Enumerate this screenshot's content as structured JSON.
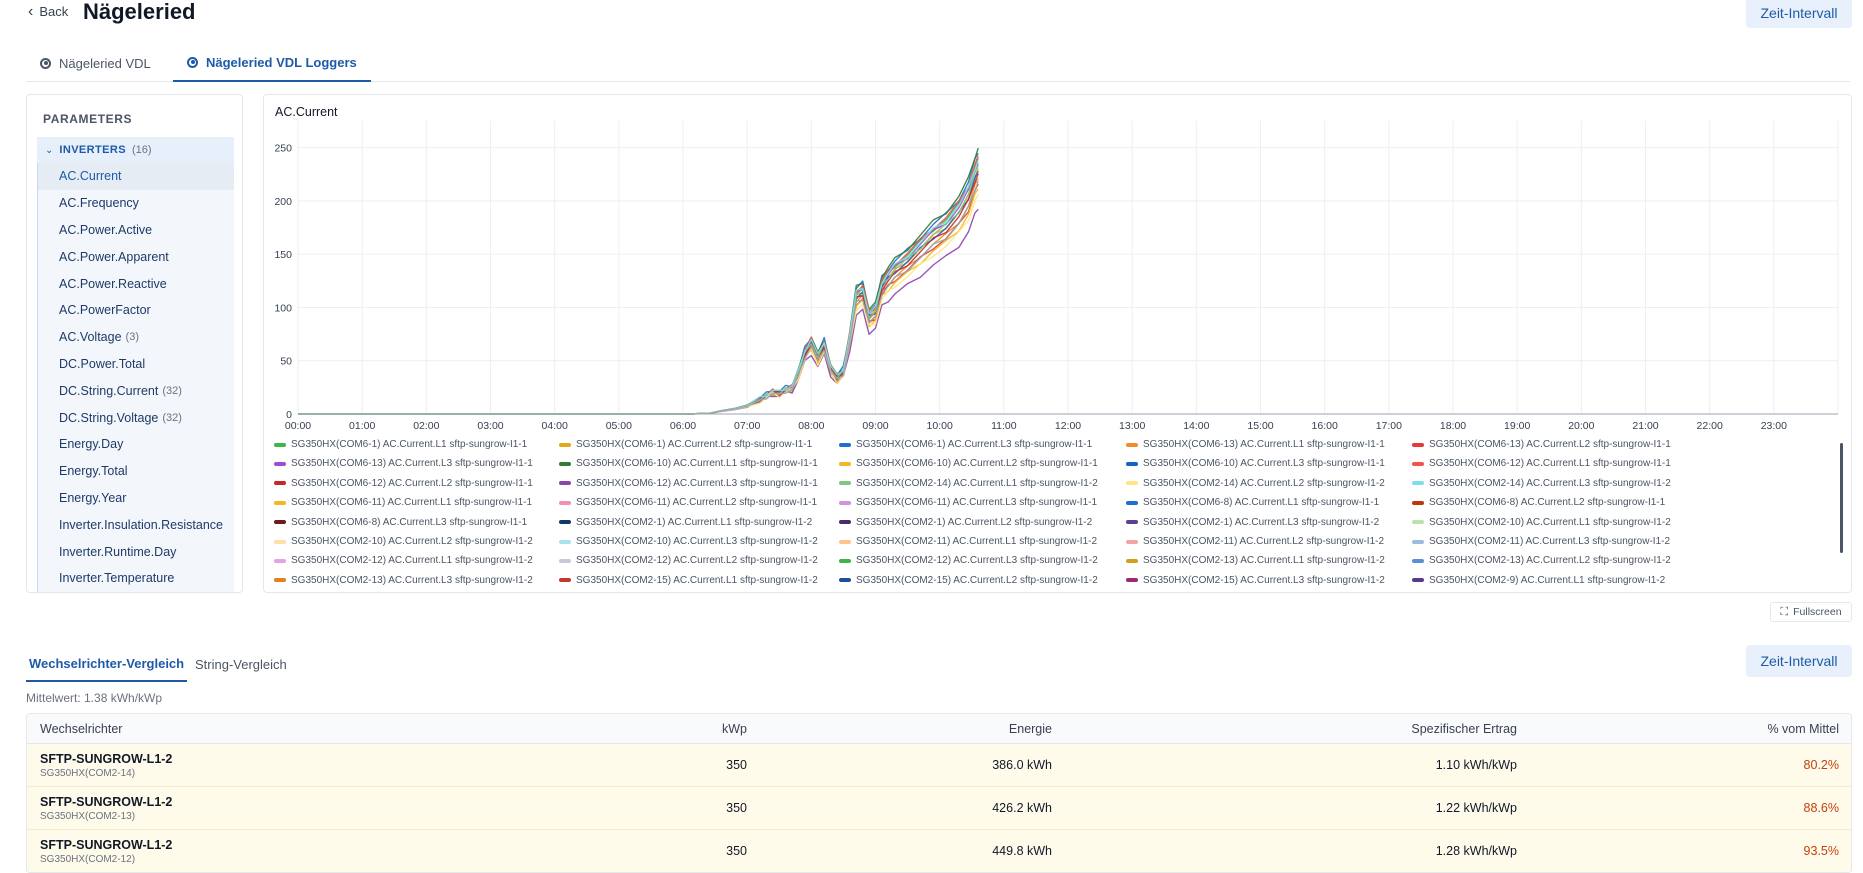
{
  "header": {
    "back_label": "Back",
    "title": "Nägeleried",
    "zeit_label": "Zeit-Intervall"
  },
  "top_tabs": [
    {
      "label": "Nägeleried VDL",
      "active": false
    },
    {
      "label": "Nägeleried VDL Loggers",
      "active": true
    }
  ],
  "params": {
    "title": "PARAMETERS",
    "group_label": "INVERTERS",
    "group_count": "(16)",
    "items": [
      {
        "label": "AC.Current",
        "count": "",
        "active": true
      },
      {
        "label": "AC.Frequency",
        "count": ""
      },
      {
        "label": "AC.Power.Active",
        "count": ""
      },
      {
        "label": "AC.Power.Apparent",
        "count": ""
      },
      {
        "label": "AC.Power.Reactive",
        "count": ""
      },
      {
        "label": "AC.PowerFactor",
        "count": ""
      },
      {
        "label": "AC.Voltage",
        "count": "(3)"
      },
      {
        "label": "DC.Power.Total",
        "count": ""
      },
      {
        "label": "DC.String.Current",
        "count": "(32)"
      },
      {
        "label": "DC.String.Voltage",
        "count": "(32)"
      },
      {
        "label": "Energy.Day",
        "count": ""
      },
      {
        "label": "Energy.Total",
        "count": ""
      },
      {
        "label": "Energy.Year",
        "count": ""
      },
      {
        "label": "Inverter.Insulation.Resistance",
        "count": ""
      },
      {
        "label": "Inverter.Runtime.Day",
        "count": ""
      },
      {
        "label": "Inverter.Temperature",
        "count": ""
      }
    ]
  },
  "chart_data": {
    "type": "line",
    "title": "AC.Current",
    "ylim": [
      0,
      275
    ],
    "yticks": [
      "0",
      "50",
      "100",
      "150",
      "200",
      "250"
    ],
    "xticks": [
      "00:00",
      "01:00",
      "02:00",
      "03:00",
      "04:00",
      "05:00",
      "06:00",
      "07:00",
      "08:00",
      "09:00",
      "10:00",
      "11:00",
      "12:00",
      "13:00",
      "14:00",
      "15:00",
      "16:00",
      "17:00",
      "18:00",
      "19:00",
      "20:00",
      "21:00",
      "22:00",
      "23:00"
    ],
    "grid": true,
    "legend_position": "bottom",
    "x": [
      0,
      6,
      6.4,
      6.6,
      6.8,
      7,
      7.2,
      7.3,
      7.4,
      7.5,
      7.6,
      7.7,
      7.8,
      7.9,
      8,
      8.1,
      8.2,
      8.3,
      8.4,
      8.5,
      8.6,
      8.7,
      8.8,
      8.9,
      9,
      9.1,
      9.2,
      9.3,
      9.5,
      9.7,
      9.9,
      10.1,
      10.3,
      10.45,
      10.55,
      10.6
    ],
    "base_series": [
      0,
      0,
      0.5,
      3,
      5,
      8,
      14,
      18,
      22,
      20,
      24,
      26,
      40,
      60,
      70,
      55,
      68,
      45,
      35,
      42,
      75,
      115,
      120,
      95,
      100,
      125,
      133,
      140,
      150,
      162,
      174,
      183,
      197,
      213,
      233,
      240
    ],
    "series_scale": [
      1.0,
      0.96,
      1.02,
      0.92,
      0.9,
      0.98,
      1.04,
      0.88,
      0.95,
      1.01,
      0.94,
      0.8,
      0.97,
      0.86,
      0.99,
      0.91
    ],
    "series_colors": [
      "#3cb54a",
      "#e6a817",
      "#1f6fd1",
      "#f28c28",
      "#e53935",
      "#9c4fd6",
      "#2e7d32",
      "#f2b824",
      "#1565c0",
      "#ef5350",
      "#c62828",
      "#8e44ad",
      "#81c784",
      "#ffe680",
      "#80deea",
      "#95a5a6"
    ],
    "legend": [
      {
        "name": "SG350HX(COM6-1) AC.Current.L1 sftp-sungrow-I1-1",
        "color": "#3cb54a"
      },
      {
        "name": "SG350HX(COM6-1) AC.Current.L2 sftp-sungrow-I1-1",
        "color": "#e6a817"
      },
      {
        "name": "SG350HX(COM6-1) AC.Current.L3 sftp-sungrow-I1-1",
        "color": "#1f6fd1"
      },
      {
        "name": "SG350HX(COM6-13) AC.Current.L1 sftp-sungrow-I1-1",
        "color": "#f28c28"
      },
      {
        "name": "SG350HX(COM6-13) AC.Current.L2 sftp-sungrow-I1-1",
        "color": "#e53935"
      },
      {
        "name": "SG350HX(COM6-13) AC.Current.L3 sftp-sungrow-I1-1",
        "color": "#9c4fd6"
      },
      {
        "name": "SG350HX(COM6-10) AC.Current.L1 sftp-sungrow-I1-1",
        "color": "#2e7d32"
      },
      {
        "name": "SG350HX(COM6-10) AC.Current.L2 sftp-sungrow-I1-1",
        "color": "#f2b824"
      },
      {
        "name": "SG350HX(COM6-10) AC.Current.L3 sftp-sungrow-I1-1",
        "color": "#1565c0"
      },
      {
        "name": "SG350HX(COM6-12) AC.Current.L1 sftp-sungrow-I1-1",
        "color": "#ef5350"
      },
      {
        "name": "SG350HX(COM6-12) AC.Current.L2 sftp-sungrow-I1-1",
        "color": "#c62828"
      },
      {
        "name": "SG350HX(COM6-12) AC.Current.L3 sftp-sungrow-I1-1",
        "color": "#8e44ad"
      },
      {
        "name": "SG350HX(COM2-14) AC.Current.L1 sftp-sungrow-I1-2",
        "color": "#81c784"
      },
      {
        "name": "SG350HX(COM2-14) AC.Current.L2 sftp-sungrow-I1-2",
        "color": "#ffe680"
      },
      {
        "name": "SG350HX(COM2-14) AC.Current.L3 sftp-sungrow-I1-2",
        "color": "#80deea"
      },
      {
        "name": "SG350HX(COM6-11) AC.Current.L1 sftp-sungrow-I1-1",
        "color": "#f2b824"
      },
      {
        "name": "SG350HX(COM6-11) AC.Current.L2 sftp-sungrow-I1-1",
        "color": "#f48fb1"
      },
      {
        "name": "SG350HX(COM6-11) AC.Current.L3 sftp-sungrow-I1-1",
        "color": "#ce93d8"
      },
      {
        "name": "SG350HX(COM6-8) AC.Current.L1 sftp-sungrow-I1-1",
        "color": "#1f6fd1"
      },
      {
        "name": "SG350HX(COM6-8) AC.Current.L2 sftp-sungrow-I1-1",
        "color": "#bf360c"
      },
      {
        "name": "SG350HX(COM6-8) AC.Current.L3 sftp-sungrow-I1-1",
        "color": "#6d1b1b"
      },
      {
        "name": "SG350HX(COM2-1) AC.Current.L1 sftp-sungrow-I1-2",
        "color": "#0d3b66"
      },
      {
        "name": "SG350HX(COM2-1) AC.Current.L2 sftp-sungrow-I1-2",
        "color": "#4a2c6b"
      },
      {
        "name": "SG350HX(COM2-1) AC.Current.L3 sftp-sungrow-I1-2",
        "color": "#5e3f8c"
      },
      {
        "name": "SG350HX(COM2-10) AC.Current.L1 sftp-sungrow-I1-2",
        "color": "#b9e4a8"
      },
      {
        "name": "SG350HX(COM2-10) AC.Current.L2 sftp-sungrow-I1-2",
        "color": "#ffe0a3"
      },
      {
        "name": "SG350HX(COM2-10) AC.Current.L3 sftp-sungrow-I1-2",
        "color": "#a8e4ef"
      },
      {
        "name": "SG350HX(COM2-11) AC.Current.L1 sftp-sungrow-I1-2",
        "color": "#ffc48a"
      },
      {
        "name": "SG350HX(COM2-11) AC.Current.L2 sftp-sungrow-I1-2",
        "color": "#f4a3a3"
      },
      {
        "name": "SG350HX(COM2-11) AC.Current.L3 sftp-sungrow-I1-2",
        "color": "#9bbbe0"
      },
      {
        "name": "SG350HX(COM2-12) AC.Current.L1 sftp-sungrow-I1-2",
        "color": "#e7a3e0"
      },
      {
        "name": "SG350HX(COM2-12) AC.Current.L2 sftp-sungrow-I1-2",
        "color": "#c8c8d8"
      },
      {
        "name": "SG350HX(COM2-12) AC.Current.L3 sftp-sungrow-I1-2",
        "color": "#3cb54a"
      },
      {
        "name": "SG350HX(COM2-13) AC.Current.L1 sftp-sungrow-I1-2",
        "color": "#d4a017"
      },
      {
        "name": "SG350HX(COM2-13) AC.Current.L2 sftp-sungrow-I1-2",
        "color": "#5b8fd6"
      },
      {
        "name": "SG350HX(COM2-13) AC.Current.L3 sftp-sungrow-I1-2",
        "color": "#e67e22"
      },
      {
        "name": "SG350HX(COM2-15) AC.Current.L1 sftp-sungrow-I1-2",
        "color": "#c0392b"
      },
      {
        "name": "SG350HX(COM2-15) AC.Current.L2 sftp-sungrow-I1-2",
        "color": "#1f4e9c"
      },
      {
        "name": "SG350HX(COM2-15) AC.Current.L3 sftp-sungrow-I1-2",
        "color": "#a0287a"
      },
      {
        "name": "SG350HX(COM2-9) AC.Current.L1 sftp-sungrow-I1-2",
        "color": "#5b3a8c"
      }
    ]
  },
  "fullscreen_label": "Fullscreen",
  "bottom": {
    "tabs": [
      {
        "label": "Wechselrichter-Vergleich",
        "active": true
      },
      {
        "label": "String-Vergleich",
        "active": false
      }
    ],
    "zeit_label": "Zeit-Intervall",
    "mittelwert": "Mittelwert: 1.38 kWh/kWp"
  },
  "table": {
    "headers": [
      "Wechselrichter",
      "kWp",
      "Energie",
      "Spezifischer Ertrag",
      "% vom Mittel"
    ],
    "rows": [
      {
        "name": "SFTP-SUNGROW-L1-2",
        "sub": "SG350HX(COM2-14)",
        "kwp": "350",
        "energie": "386.0 kWh",
        "ertrag": "1.10 kWh/kWp",
        "pct": "80.2%"
      },
      {
        "name": "SFTP-SUNGROW-L1-2",
        "sub": "SG350HX(COM2-13)",
        "kwp": "350",
        "energie": "426.2 kWh",
        "ertrag": "1.22 kWh/kWp",
        "pct": "88.6%"
      },
      {
        "name": "SFTP-SUNGROW-L1-2",
        "sub": "SG350HX(COM2-12)",
        "kwp": "350",
        "energie": "449.8 kWh",
        "ertrag": "1.28 kWh/kWp",
        "pct": "93.5%"
      }
    ]
  }
}
